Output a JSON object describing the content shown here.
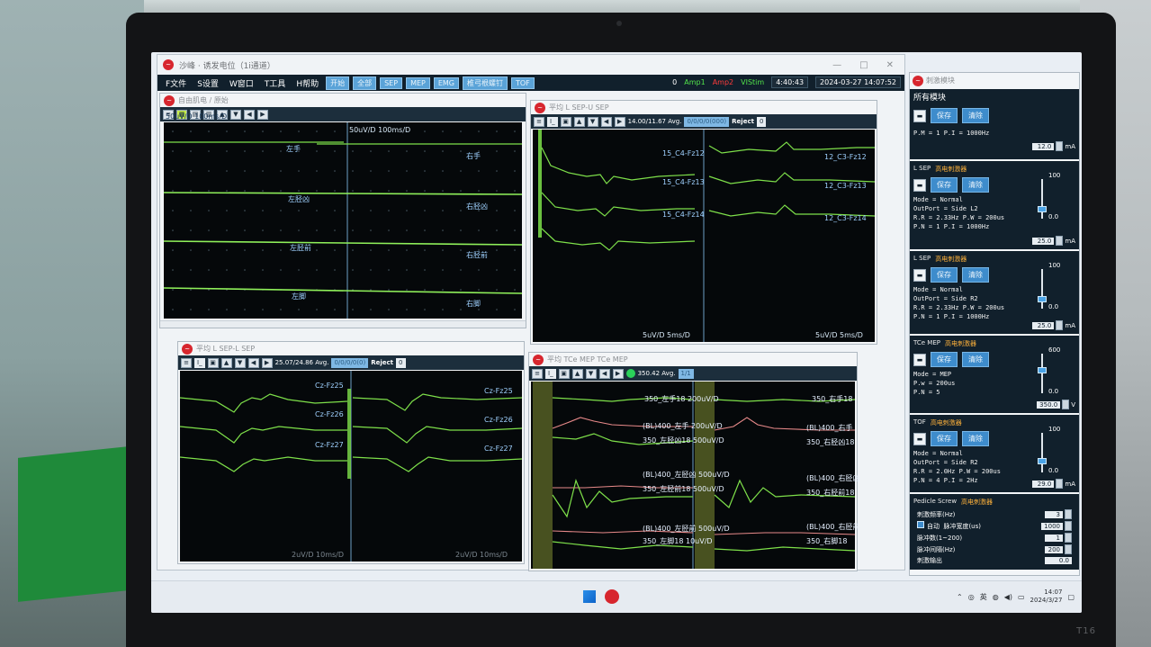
{
  "app": {
    "title": "沙峰 · 诱发电位（1i通道）",
    "menus": [
      "F文件",
      "S设置",
      "W窗口",
      "T工具",
      "H帮助"
    ],
    "toolbar_buttons": [
      "开始",
      "全部",
      "SEP",
      "MEP",
      "EMG",
      "椎弓根螺钉",
      "TOF",
      "OFF"
    ],
    "status": {
      "counter": "0",
      "amp1": "Amp1",
      "amp2": "Amp2",
      "vistim": "VIStim",
      "elapsed": "4:40:43",
      "datetime": "2024-03-27  14:07:52"
    }
  },
  "panels": {
    "top_left": {
      "title": "自由肌电 / 原始",
      "left_header": "50uV/D  100ms/D",
      "right_header": "50uV/D  100ms/D",
      "left_labels": [
        "左手",
        "左胫凶",
        "左胫前",
        "左脚"
      ],
      "right_labels": [
        "右手",
        "右胫凶",
        "右胫前",
        "右脚"
      ]
    },
    "top_right": {
      "title": "平均 L SEP-U SEP",
      "avg": "14.00/11.67 Avg.",
      "box": "0/0/0/0(000)",
      "reject": "Reject",
      "reject_value": "0",
      "left_labels": [
        "15_C4-Fz12",
        "15_C4-Fz13",
        "15_C4-Fz14"
      ],
      "right_labels": [
        "12_C3-Fz12",
        "12_C3-Fz13",
        "12_C3-Fz14"
      ],
      "scale_left": "5uV/D  5ms/D",
      "scale_right": "5uV/D  5ms/D"
    },
    "bottom_left": {
      "title": "平均 L SEP-L SEP",
      "avg": "25.07/24.86 Avg.",
      "box": "0/0/0/0(0)",
      "reject": "Reject",
      "reject_value": "0",
      "left_labels": [
        "Cz-Fz25",
        "Cz-Fz26",
        "Cz-Fz27"
      ],
      "right_labels": [
        "Cz-Fz25",
        "Cz-Fz26",
        "Cz-Fz27"
      ],
      "scale_left": "2uV/D  10ms/D",
      "scale_right": "2uV/D  10ms/D"
    },
    "bottom_right": {
      "title": "平均 TCe MEP  TCe MEP",
      "avg": "350.42 Avg.",
      "box": "1/1",
      "left_labels": [
        "350_左手18  200uV/D",
        "(BL)400_左手  200uV/D",
        "350_左胫凶18  500uV/D",
        "(BL)400_左胫凶  500uV/D",
        "350_左胫前18  500uV/D",
        "(BL)400_左胫前  500uV/D",
        "350_左脚18  10uV/D"
      ],
      "right_labels": [
        "350_右手18",
        "(BL)400_右手",
        "350_右胫凶18",
        "(BL)400_右胫凶",
        "350_右胫前18",
        "(BL)400_右胫前",
        "350_右脚18"
      ]
    }
  },
  "sidebar": {
    "window_title": "刺激模块",
    "heading": "所有模块",
    "save": "保存",
    "clear": "清除",
    "top_block": {
      "line": "P.M = 1   P.I = 1000Hz",
      "value": "12.0",
      "unit": "mA"
    },
    "modules": [
      {
        "name": "L SEP",
        "cn": "高电刺激器",
        "lines": [
          "Mode = Normal",
          "OutPort = Side L2",
          "R.R = 2.33Hz  P.W = 200us",
          "P.N = 1  P.I = 1000Hz"
        ],
        "max": "100",
        "min": "0.0",
        "value": "25.0",
        "unit": "mA",
        "level": 0.25
      },
      {
        "name": "L SEP",
        "cn": "高电刺激器",
        "lines": [
          "Mode = Normal",
          "OutPort = Side R2",
          "R.R = 2.33Hz  P.W = 200us",
          "P.N = 1  P.I = 1000Hz"
        ],
        "max": "100",
        "min": "0.0",
        "value": "25.0",
        "unit": "mA",
        "level": 0.25
      },
      {
        "name": "TCe MEP",
        "cn": "高电刺激器",
        "lines": [
          "Mode = MEP",
          "P.w = 200us",
          "P.N = 5"
        ],
        "max": "600",
        "min": "0.0",
        "value": "350.0",
        "unit": "V",
        "level": 0.58
      },
      {
        "name": "TOF",
        "cn": "高电刺激器",
        "lines": [
          "Mode = Normal",
          "OutPort = Side R2",
          "R.R = 2.0Hz  P.W = 200us",
          "P.N = 4  P.I = 2Hz"
        ],
        "max": "100",
        "min": "0.0",
        "value": "29.0",
        "unit": "mA",
        "level": 0.29
      }
    ],
    "pedicle": {
      "name": "Pedicle Screw",
      "cn": "高电刺激器",
      "auto": "自动",
      "rows": [
        {
          "label": "刺激频率(Hz)",
          "value": "3"
        },
        {
          "label": "脉冲宽度(us)",
          "value": "1000"
        },
        {
          "label": "脉冲数(1~200)",
          "value": "1"
        },
        {
          "label": "脉冲间隔(Hz)",
          "value": "200"
        }
      ],
      "footer_label": "刺激输出",
      "footer_value": "0.0"
    }
  },
  "taskbar": {
    "tray_lang": "英",
    "time": "14:07",
    "date": "2024/3/27"
  },
  "device": {
    "brand": "T16"
  }
}
